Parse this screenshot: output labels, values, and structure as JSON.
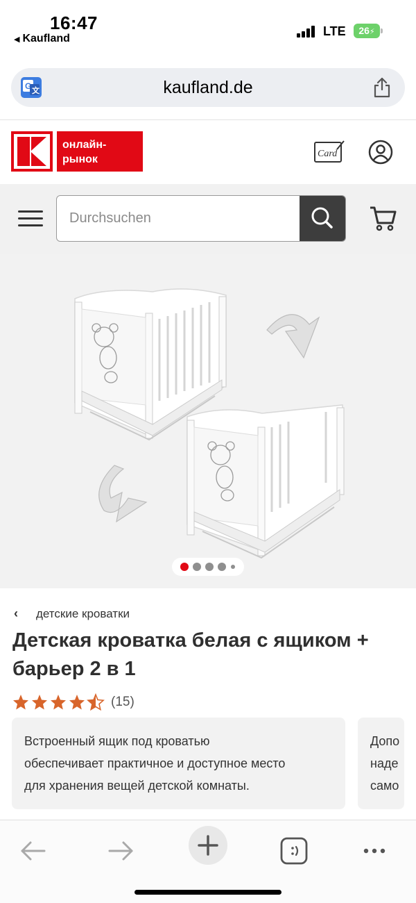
{
  "status_bar": {
    "time": "16:47",
    "back_app": "Kaufland",
    "network": "LTE",
    "battery": "26"
  },
  "browser": {
    "url": "kaufland.de",
    "translate_icon": "translate-icon",
    "share_icon": "share-icon"
  },
  "header": {
    "logo_text": "онлайн-рынок",
    "card_icon": "kaufland-card-icon",
    "account_icon": "user-account-icon",
    "brand_color": "#e10915"
  },
  "search": {
    "placeholder": "Durchsuchen",
    "value": ""
  },
  "gallery": {
    "image_count": 5,
    "active_index": 0
  },
  "product": {
    "breadcrumb": "детские кроватки",
    "title": "Детская кроватка белая с ящиком + барьер 2 в 1",
    "rating": 4.5,
    "review_count": "(15)",
    "features": [
      "Встроенный ящик под кроватью\nобеспечивает практичное и доступное место\nдля хранения вещей детской комнаты.",
      "Допо\nнаде\nсамо"
    ]
  },
  "toolbar": {
    "back_icon": "arrow-left-icon",
    "forward_icon": "arrow-right-icon",
    "new_tab_icon": "plus-icon",
    "tabs_icon": "tabs-icon",
    "more_icon": "more-dots-icon"
  }
}
